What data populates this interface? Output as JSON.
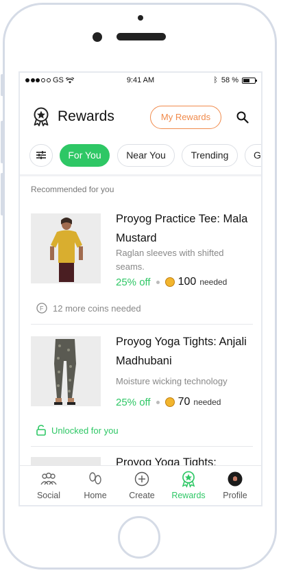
{
  "status_bar": {
    "carrier": "GS",
    "time": "9:41 AM",
    "battery": "58 %"
  },
  "header": {
    "title": "Rewards",
    "my_rewards_label": "My Rewards"
  },
  "filters": {
    "chips": [
      "For You",
      "Near You",
      "Trending",
      "Ga"
    ]
  },
  "section_label": "Recommended for you",
  "products": [
    {
      "name": "Proyog Practice Tee: Mala Mustard",
      "description": "Raglan sleeves with shifted seams.",
      "discount": "25% off",
      "coins": "100",
      "needed_label": "needed",
      "footer": "12 more coins needed"
    },
    {
      "name": "Proyog Yoga Tights: Anjali Madhubani",
      "description": "Moisture wicking technology",
      "discount": "25% off",
      "coins": "70",
      "needed_label": "needed",
      "footer": "Unlocked for you"
    },
    {
      "name": "Proyog Yoga Tights:"
    }
  ],
  "tabs": [
    {
      "label": "Social",
      "icon": "people-icon"
    },
    {
      "label": "Home",
      "icon": "feet-icon"
    },
    {
      "label": "Create",
      "icon": "plus-circle-icon"
    },
    {
      "label": "Rewards",
      "icon": "award-icon",
      "active": true
    },
    {
      "label": "Profile",
      "icon": "avatar"
    }
  ],
  "colors": {
    "accent": "#2ec765",
    "orange": "#f08a4b"
  }
}
